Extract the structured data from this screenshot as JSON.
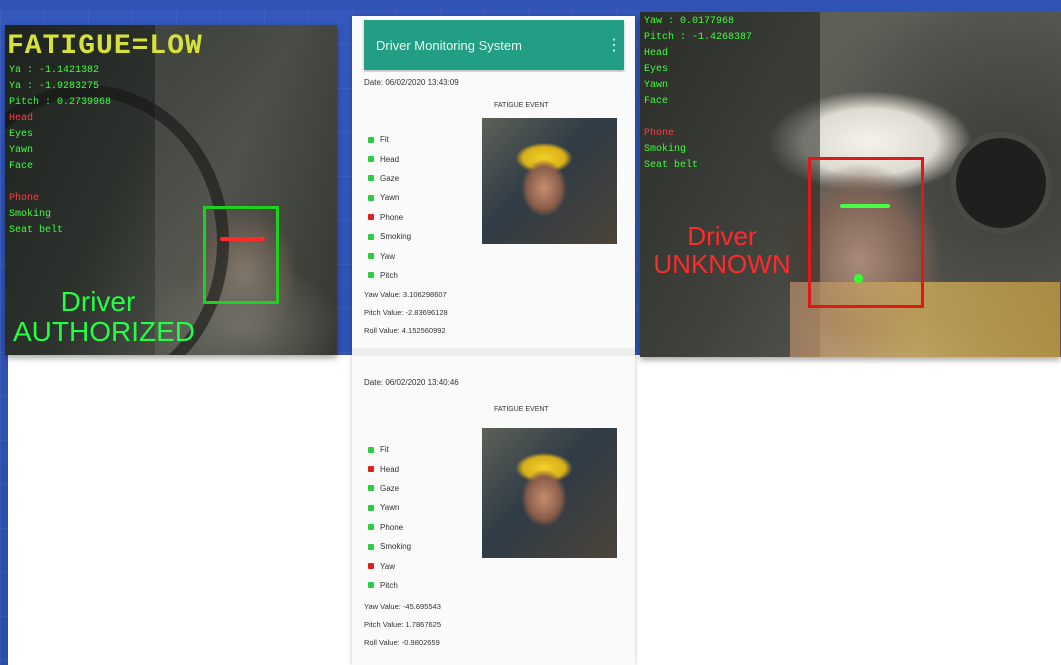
{
  "left_camera": {
    "fatigue": "FATIGUE=LOW",
    "hud_lines": [
      "Ya : -1.1421382",
      "Ya : -1.9283275",
      "Pitch : 0.2739968",
      "Head",
      "Eyes",
      "Yawn",
      "Face",
      "",
      "Phone",
      "Smoking",
      "Seat belt"
    ],
    "driver_line1": "Driver",
    "driver_line2": "AUTHORIZED"
  },
  "right_camera": {
    "hud_lines": [
      "Yaw : 0.0177968",
      "Pitch : -1.4268387",
      "Head",
      "Eyes",
      "Yawn",
      "Face",
      "",
      "Phone",
      "Smoking",
      "Seat belt"
    ],
    "driver_line1": "Driver",
    "driver_line2": "UNKNOWN"
  },
  "app": {
    "title": "Driver Monitoring System",
    "menu_icon": "⋮",
    "events": [
      {
        "date": "Date: 06/02/2020 13:43:09",
        "title": "FATIGUE EVENT",
        "statuses": [
          {
            "label": "Fit",
            "color": "#2ecc40"
          },
          {
            "label": "Head",
            "color": "#2ecc40"
          },
          {
            "label": "Gaze",
            "color": "#2ecc40"
          },
          {
            "label": "Yawn",
            "color": "#2ecc40"
          },
          {
            "label": "Phone",
            "color": "#e02020"
          },
          {
            "label": "Smoking",
            "color": "#2ecc40"
          },
          {
            "label": "Yaw",
            "color": "#2ecc40"
          },
          {
            "label": "Pitch",
            "color": "#2ecc40"
          }
        ],
        "yaw": "Yaw Value: 3.106298607",
        "pitch": "Pitch Value: -2.83696128",
        "roll": "Roll Value: 4.152560992"
      },
      {
        "date": "Date: 06/02/2020 13:40:46",
        "title": "FATIGUE EVENT",
        "statuses": [
          {
            "label": "Fit",
            "color": "#2ecc40"
          },
          {
            "label": "Head",
            "color": "#e02020"
          },
          {
            "label": "Gaze",
            "color": "#2ecc40"
          },
          {
            "label": "Yawn",
            "color": "#2ecc40"
          },
          {
            "label": "Phone",
            "color": "#2ecc40"
          },
          {
            "label": "Smoking",
            "color": "#2ecc40"
          },
          {
            "label": "Yaw",
            "color": "#e02020"
          },
          {
            "label": "Pitch",
            "color": "#2ecc40"
          }
        ],
        "yaw": "Yaw Value: -45.695543",
        "pitch": "Pitch Value: 1.7867625",
        "roll": "Roll Value: -0.9802659"
      }
    ]
  }
}
